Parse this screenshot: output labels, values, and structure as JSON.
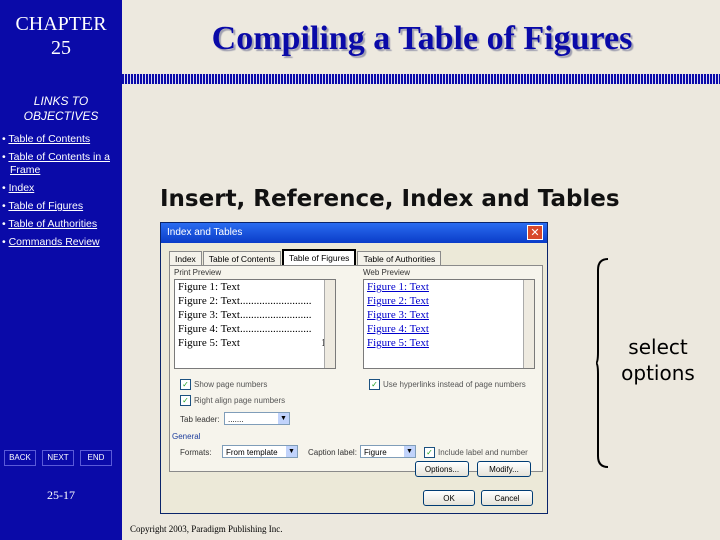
{
  "sidebar": {
    "chapter_line1": "CHAPTER",
    "chapter_line2": "25",
    "links_heading_line1": "LINKS TO",
    "links_heading_line2": "OBJECTIVES",
    "objectives": [
      "Table of Contents",
      "Table of Contents in a Frame",
      "Index",
      "Table of Figures",
      "Table of Authorities",
      "Commands Review"
    ],
    "nav": {
      "back": "BACK",
      "next": "NEXT",
      "end": "END"
    },
    "page_number": "25-17"
  },
  "slide": {
    "title": "Compiling a Table of Figures",
    "heading": "Insert, Reference, Index and Tables",
    "callout_line1": "select",
    "callout_line2": "options",
    "copyright": "Copyright 2003, Paradigm Publishing Inc."
  },
  "dialog": {
    "title": "Index and Tables",
    "close_glyph": "✕",
    "tabs": [
      "Index",
      "Table of Contents",
      "Table of Figures",
      "Table of Authorities"
    ],
    "print_preview_label": "Print Preview",
    "web_preview_label": "Web Preview",
    "print_preview_rows": [
      {
        "entry": "Figure 1: Text",
        "page": "1"
      },
      {
        "entry": "Figure 2: Text..........................",
        "page": "3"
      },
      {
        "entry": "Figure 3: Text..........................",
        "page": "5"
      },
      {
        "entry": "Figure 4: Text..........................",
        "page": "7"
      },
      {
        "entry": "Figure 5: Text",
        "page": "10"
      }
    ],
    "web_preview_rows": [
      "Figure 1: Text",
      "Figure 2: Text",
      "Figure 3: Text",
      "Figure 4: Text",
      "Figure 5: Text"
    ],
    "show_page_numbers": "Show page numbers",
    "right_align_page_numbers": "Right align page numbers",
    "use_hyperlinks": "Use hyperlinks instead of page numbers",
    "tab_leader_label": "Tab leader:",
    "tab_leader_value": ".......",
    "general_label": "General",
    "formats_label": "Formats:",
    "formats_value": "From template",
    "caption_label": "Caption label:",
    "caption_value": "Figure",
    "include_label_number": "Include label and number",
    "options_button": "Options...",
    "modify_button": "Modify...",
    "ok_button": "OK",
    "cancel_button": "Cancel",
    "check_glyph": "✓",
    "dropdown_glyph": "▼"
  },
  "colors": {
    "sidebar_blue": "#0a0aa8",
    "title_blue": "#0a0aa8",
    "dialog_title": "#0a3cc8"
  }
}
